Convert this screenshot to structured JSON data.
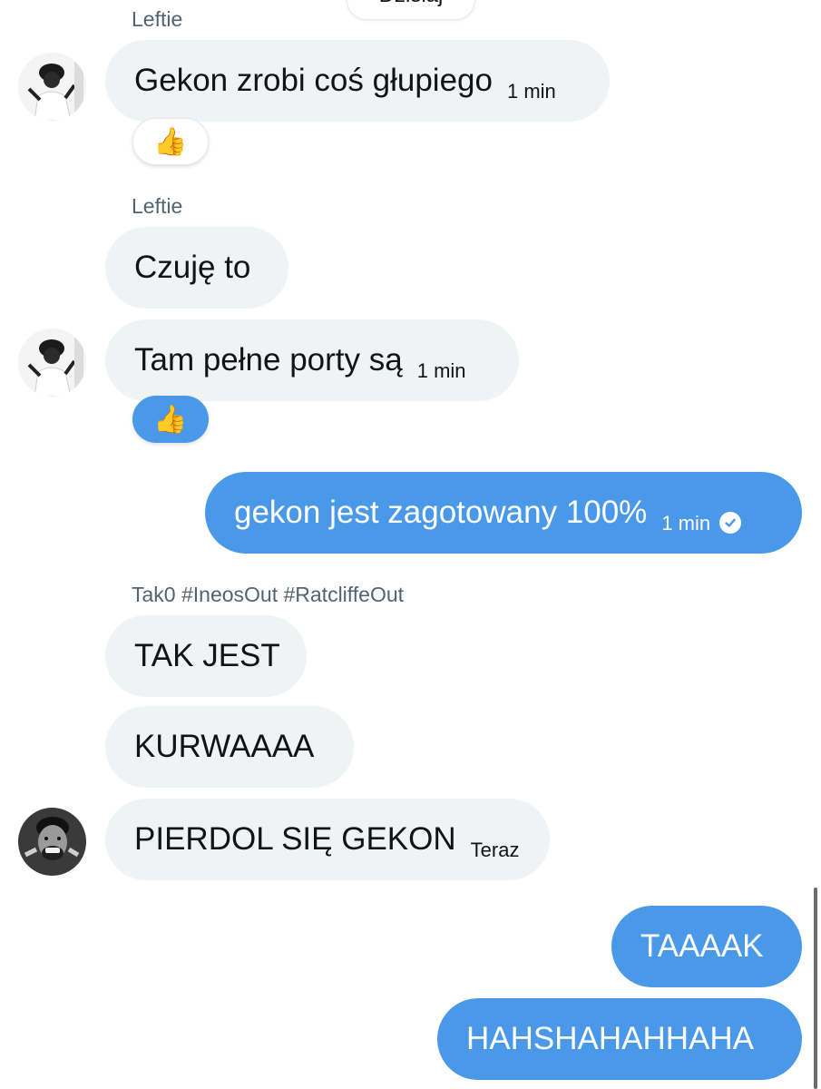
{
  "date_divider": "Dzisiaj",
  "messages": [
    {
      "sender": "Leftie",
      "text": "Gekon zrobi coś głupiego",
      "time": "1 min",
      "reaction": "👍"
    },
    {
      "sender": "Leftie",
      "text": "Czuję to"
    },
    {
      "text": "Tam pełne porty są",
      "time": "1 min",
      "reaction": "👍"
    },
    {
      "text": "gekon jest zagotowany 100%",
      "time": "1 min",
      "status": "sent"
    },
    {
      "sender": "Tak0 #IneosOut #RatcliffeOut",
      "text": "TAK JEST"
    },
    {
      "text": "KURWAAAA"
    },
    {
      "text": "PIERDOL SIĘ GEKON",
      "time": "Teraz"
    },
    {
      "text": "TAAAAK"
    },
    {
      "text": "HAHSHAHAHHAHA"
    }
  ],
  "colors": {
    "outgoing_bubble": "#4a99e9",
    "incoming_bubble": "#eff3f4",
    "sender_name": "#536471"
  },
  "icons": {
    "read_receipt": "check-circle-icon",
    "avatar_1": "user-avatar-leftie",
    "avatar_2": "user-avatar-tak0"
  }
}
